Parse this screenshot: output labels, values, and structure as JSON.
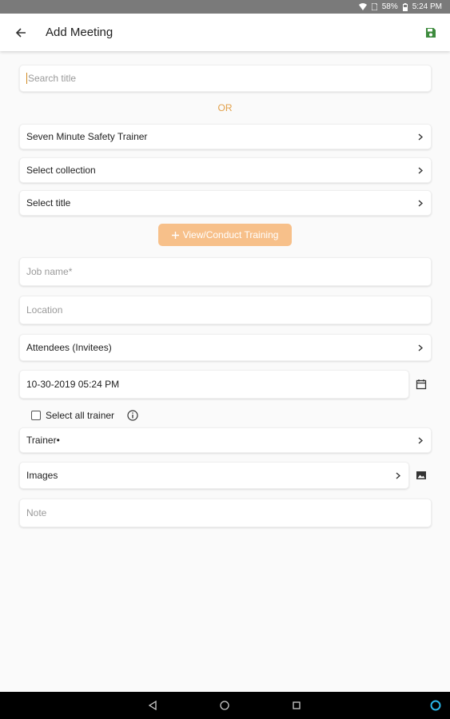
{
  "status_bar": {
    "battery": "58%",
    "time": "5:24 PM"
  },
  "app_bar": {
    "title": "Add Meeting"
  },
  "search": {
    "placeholder": "Search title"
  },
  "or_label": "OR",
  "rows": {
    "trainer_program": "Seven Minute Safety Trainer",
    "collection": "Select collection",
    "title": "Select title"
  },
  "cta": {
    "label": "View/Conduct Training",
    "icon": "plus-icon"
  },
  "job_name": {
    "placeholder": "Job name*"
  },
  "location": {
    "placeholder": "Location"
  },
  "attendees": {
    "label": "Attendees (Invitees)"
  },
  "datetime": {
    "value": "10-30-2019 05:24 PM"
  },
  "select_all": {
    "label": "Select all trainer",
    "checked": false
  },
  "trainer": {
    "label": "Trainer•"
  },
  "images": {
    "label": "Images"
  },
  "note": {
    "placeholder": "Note"
  },
  "colors": {
    "accent": "#e2a04a",
    "button": "#f7c08a",
    "save_icon": "#3d8b3d",
    "status_bar": "#7a7a7a"
  }
}
